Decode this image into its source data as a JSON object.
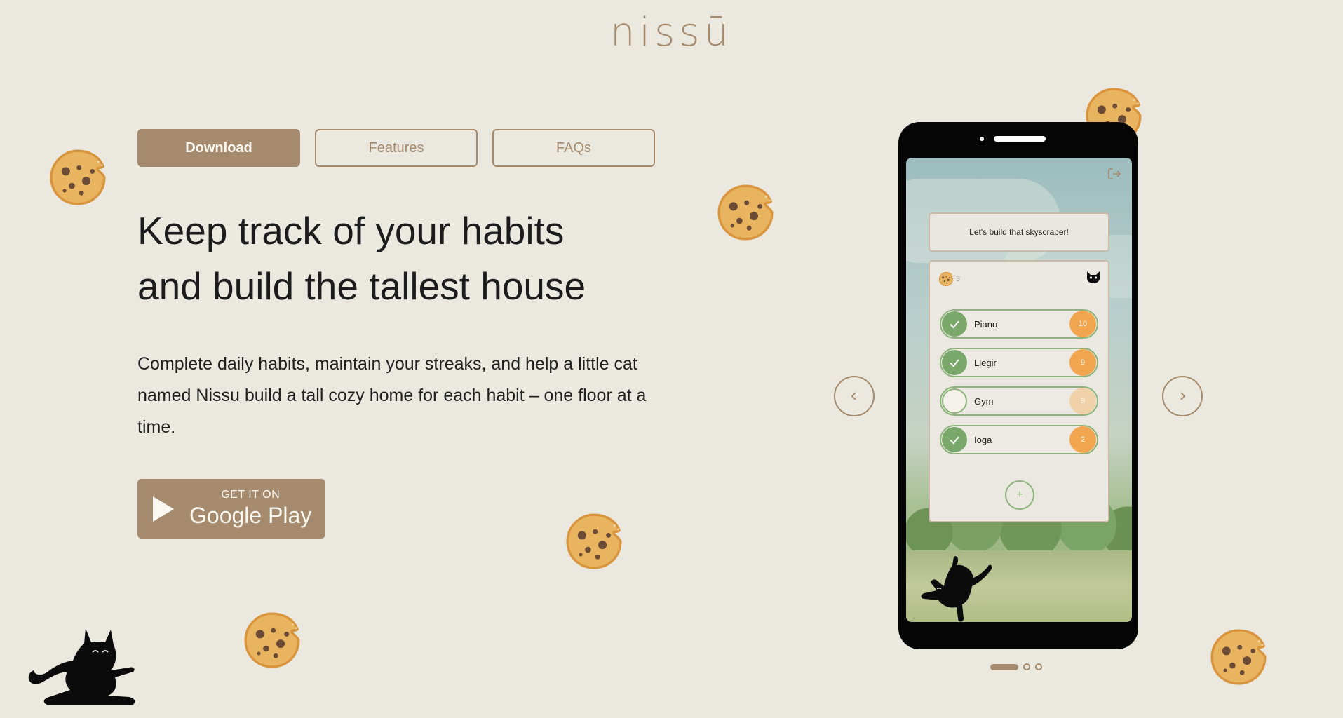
{
  "brand": {
    "logo_text": "nissū",
    "color": "#a58a6d"
  },
  "nav": {
    "items": [
      {
        "label": "Download",
        "active": true
      },
      {
        "label": "Features",
        "active": false
      },
      {
        "label": "FAQs",
        "active": false
      }
    ]
  },
  "hero": {
    "headline_line1": "Keep track of your habits",
    "headline_line2": "and build the tallest house",
    "description": "Complete daily habits, maintain your streaks, and help a little cat named Nissu build a tall cozy home for each habit – one floor at a time."
  },
  "store_badge": {
    "small_text": "GET IT ON",
    "big_text": "Google Play"
  },
  "app_screen": {
    "banner": "Let's build that skyscraper!",
    "cookie_count": "3",
    "habits": [
      {
        "name": "Piano",
        "streak": "10",
        "done": true
      },
      {
        "name": "Llegir",
        "streak": "9",
        "done": true
      },
      {
        "name": "Gym",
        "streak": "9",
        "done": false
      },
      {
        "name": "Ioga",
        "streak": "2",
        "done": true
      }
    ],
    "add_label": "+"
  },
  "carousel": {
    "slides_total": 3,
    "active_index": 0
  },
  "icons": {
    "logout": "logout-icon",
    "prev": "chevron-left-icon",
    "next": "chevron-right-icon",
    "check": "check-icon",
    "cookie": "cookie-icon",
    "cat": "cat-icon",
    "play": "play-icon"
  },
  "colors": {
    "background": "#eae8df",
    "accent": "#a58a6d",
    "habit_green": "#7aa86a",
    "streak_orange": "#f2a54f"
  }
}
